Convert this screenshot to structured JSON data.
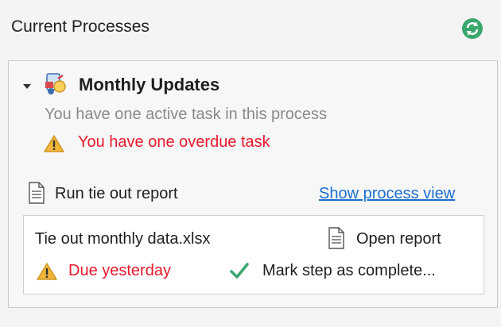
{
  "panel": {
    "title": "Current Processes"
  },
  "process": {
    "name": "Monthly Updates",
    "active_text": "You have one active task in this process",
    "overdue_text": "You have one overdue task"
  },
  "task": {
    "name": "Run tie out report",
    "link_label": "Show process view",
    "file_name": "Tie out monthly data.xlsx",
    "open_label": "Open report",
    "due_text": "Due yesterday",
    "mark_label": "Mark step as complete..."
  },
  "colors": {
    "accent_green": "#3aa76d",
    "warning_red": "#e8192c",
    "link_blue": "#1a6fd1",
    "warning_amber": "#e3a52c"
  },
  "icons": {
    "refresh": "refresh-icon",
    "expander": "collapse-triangle-icon",
    "process": "process-icon",
    "warning": "warning-icon",
    "document": "document-icon",
    "check": "checkmark-icon"
  }
}
